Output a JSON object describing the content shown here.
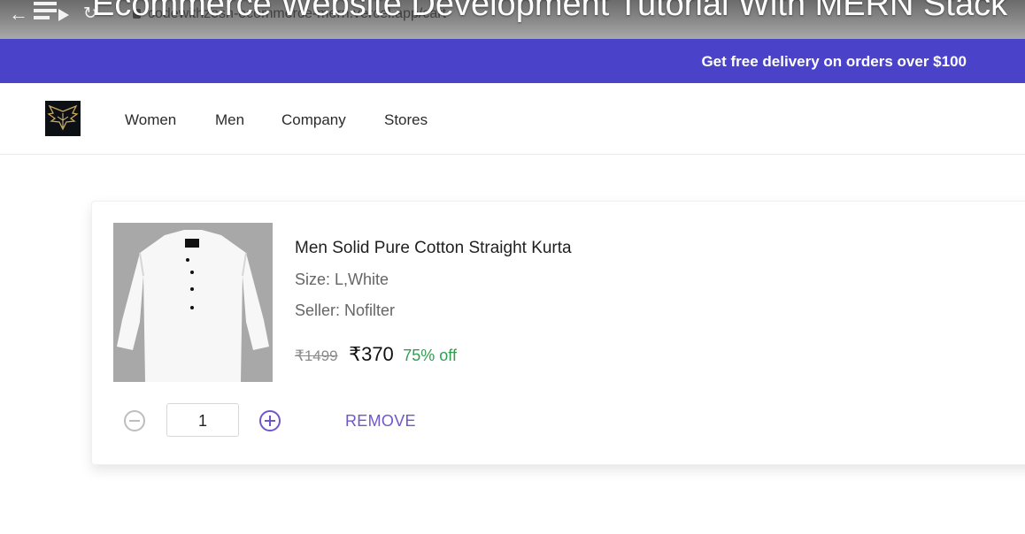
{
  "browser": {
    "url": "codewithzosh-ecommerce-mern.vercel.app/cart",
    "video_title": "Ecommerce Website Development Tutorial With MERN Stack",
    "icons": [
      "back-arrow-icon",
      "playlist-icon",
      "reload-icon",
      "lock-icon"
    ]
  },
  "banner": {
    "text": "Get free delivery on orders over $100",
    "color": "#4a42c9"
  },
  "nav": {
    "items": [
      {
        "label": "Women"
      },
      {
        "label": "Men"
      },
      {
        "label": "Company"
      },
      {
        "label": "Stores"
      }
    ],
    "logo_icon": "eagle-logo-icon"
  },
  "cart_item": {
    "title": "Men Solid Pure Cotton Straight Kurta",
    "size": "Size: L,White",
    "seller": "Seller: Nofilter",
    "mrp": "₹1499",
    "price": "₹370",
    "discount": "75% off",
    "quantity": "1",
    "remove_label": "REMOVE",
    "image_icon": "white-kurta-shirt-image",
    "accent_color": "#6f57c9",
    "discount_color": "#2f9e51"
  }
}
